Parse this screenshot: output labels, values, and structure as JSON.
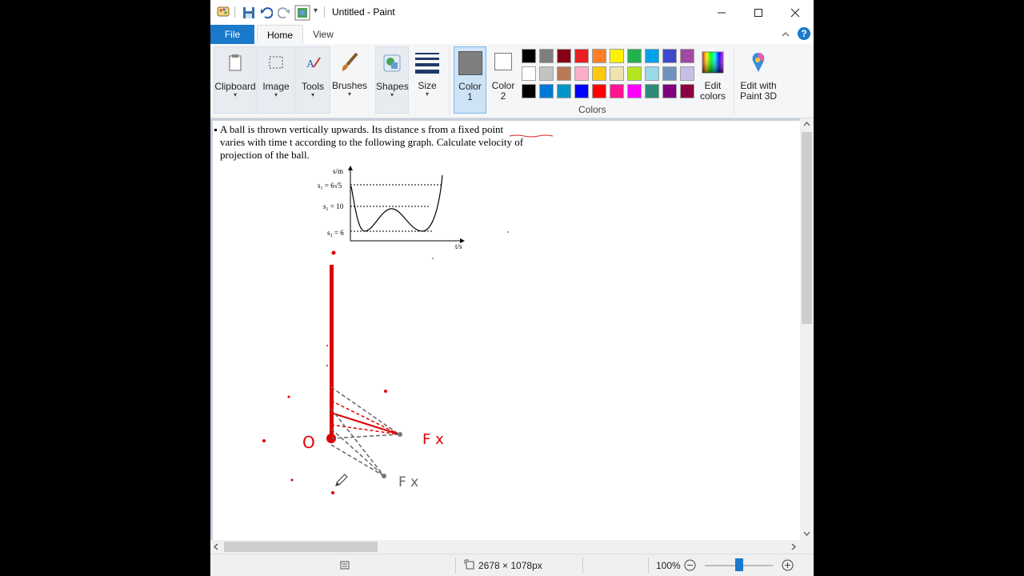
{
  "window": {
    "title": "Untitled - Paint"
  },
  "tabs": {
    "file": "File",
    "home": "Home",
    "view": "View"
  },
  "ribbon": {
    "clipboard": "Clipboard",
    "image": "Image",
    "tools": "Tools",
    "brushes": "Brushes",
    "shapes": "Shapes",
    "size": "Size",
    "color1": "Color",
    "color1_num": "1",
    "color2": "Color",
    "color2_num": "2",
    "edit_colors_1": "Edit",
    "edit_colors_2": "colors",
    "paint3d_1": "Edit with",
    "paint3d_2": "Paint 3D",
    "colors_group": "Colors",
    "dropdown_glyph": "▾"
  },
  "palette": {
    "row1": [
      "#000000",
      "#7f7f7f",
      "#880015",
      "#ed1c24",
      "#ff7f27",
      "#fff200",
      "#22b14c",
      "#00a2e8",
      "#3f48cc",
      "#a349a4"
    ],
    "row2": [
      "#ffffff",
      "#c3c3c3",
      "#b97a57",
      "#ffaec9",
      "#ffc90e",
      "#efe4b0",
      "#b5e61d",
      "#99d9ea",
      "#7092be",
      "#c8bfe7"
    ],
    "row3": [
      "#000000",
      "#0078d7",
      "#0096c7",
      "#0000ff",
      "#ff0000",
      "#ff1493",
      "#ff00ff",
      "#2e8b7a",
      "#800080",
      "#8b0040"
    ],
    "color1": "#7f7f7f",
    "color2": "#ffffff"
  },
  "document": {
    "line1": "A ball is thrown vertically upwards. Its distance s from a fixed point",
    "line2": "varies with time t according to the following graph. Calculate velocity of",
    "line3": "projection of the ball.",
    "y_axis": "s/m",
    "s1": "s₁ = 6√5",
    "s2": "s₂ = 10",
    "s3": "s₃ = 6",
    "x_axis": "t/s",
    "label_o": "O",
    "label_f1": "F x",
    "label_f2": "F x"
  },
  "status": {
    "dimensions": "2678 × 1078px",
    "zoom": "100%"
  }
}
